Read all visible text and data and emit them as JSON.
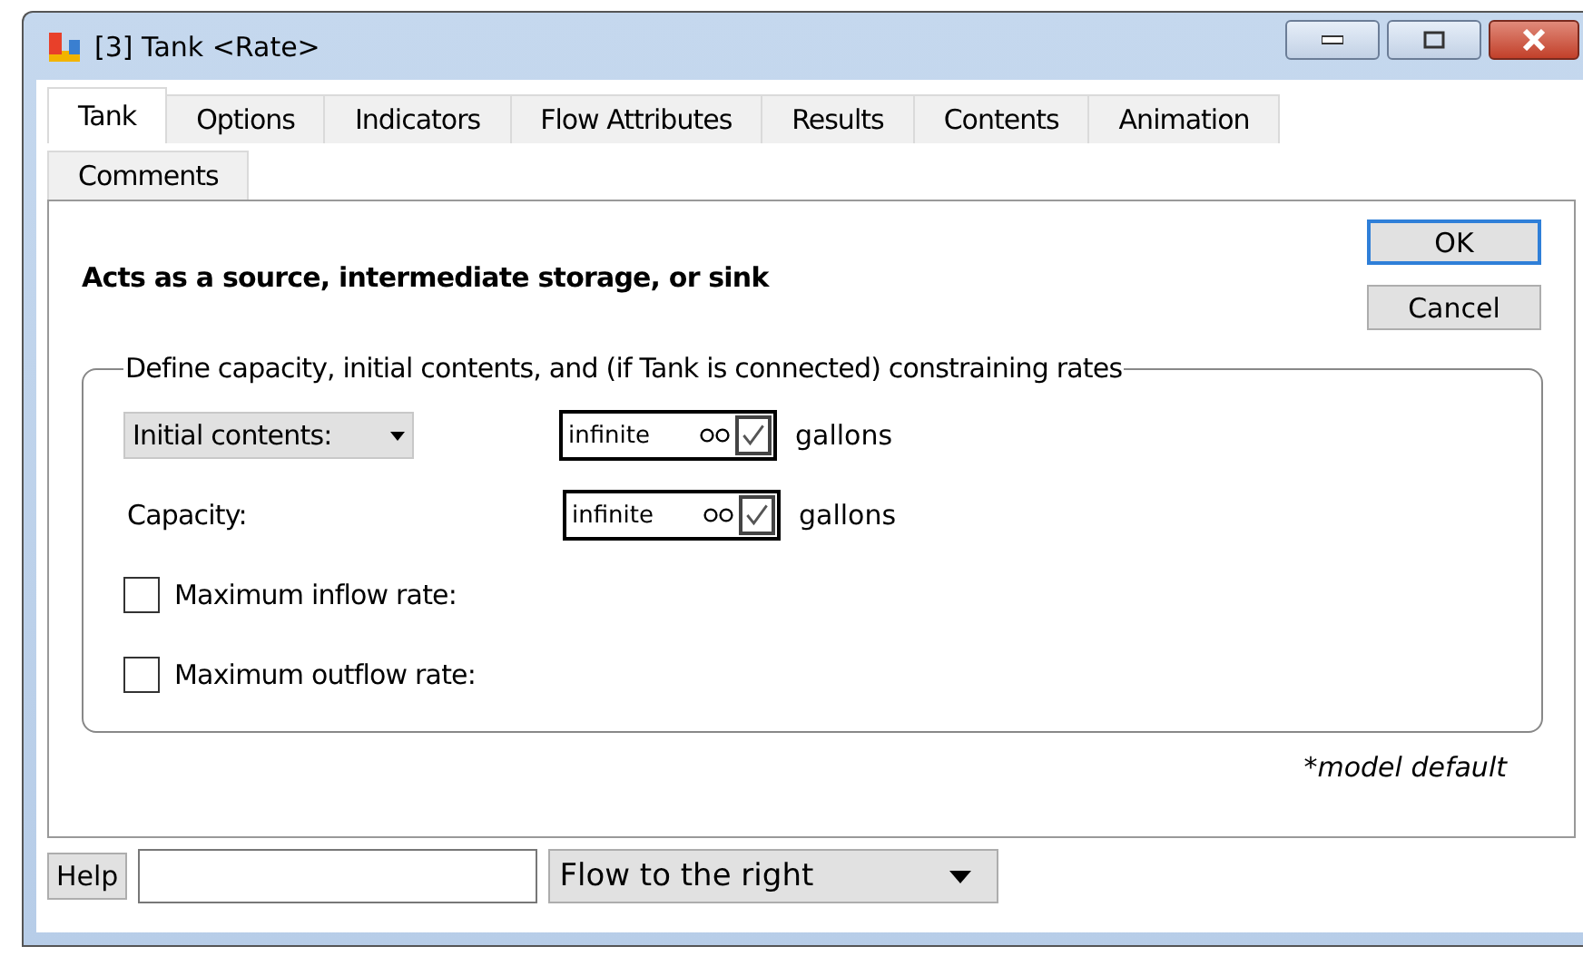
{
  "window": {
    "title": "[3] Tank <Rate>"
  },
  "tabs": [
    {
      "label": "Tank",
      "selected": true
    },
    {
      "label": "Options",
      "selected": false
    },
    {
      "label": "Indicators",
      "selected": false
    },
    {
      "label": "Flow Attributes",
      "selected": false
    },
    {
      "label": "Results",
      "selected": false
    },
    {
      "label": "Contents",
      "selected": false
    },
    {
      "label": "Animation",
      "selected": false
    },
    {
      "label": "Comments",
      "selected": false
    }
  ],
  "description": "Acts as a source, intermediate storage, or sink",
  "buttons": [
    "OK",
    "Cancel"
  ],
  "group": {
    "title": "Define capacity, initial contents, and (if Tank is connected) constraining rates",
    "rows": [
      {
        "kind": "dropdown",
        "label": "Initial contents:",
        "value": "infinite",
        "infinite_checked": true,
        "unit": "gallons"
      },
      {
        "kind": "label",
        "label": "Capacity:",
        "value": "infinite",
        "infinite_checked": true,
        "unit": "gallons"
      },
      {
        "kind": "checkbox",
        "label": "Maximum inflow rate:",
        "checked": false
      },
      {
        "kind": "checkbox",
        "label": "Maximum outflow rate:",
        "checked": false
      }
    ]
  },
  "note": "*model default",
  "footer": {
    "help": "Help",
    "flow_select": "Flow to the right"
  }
}
